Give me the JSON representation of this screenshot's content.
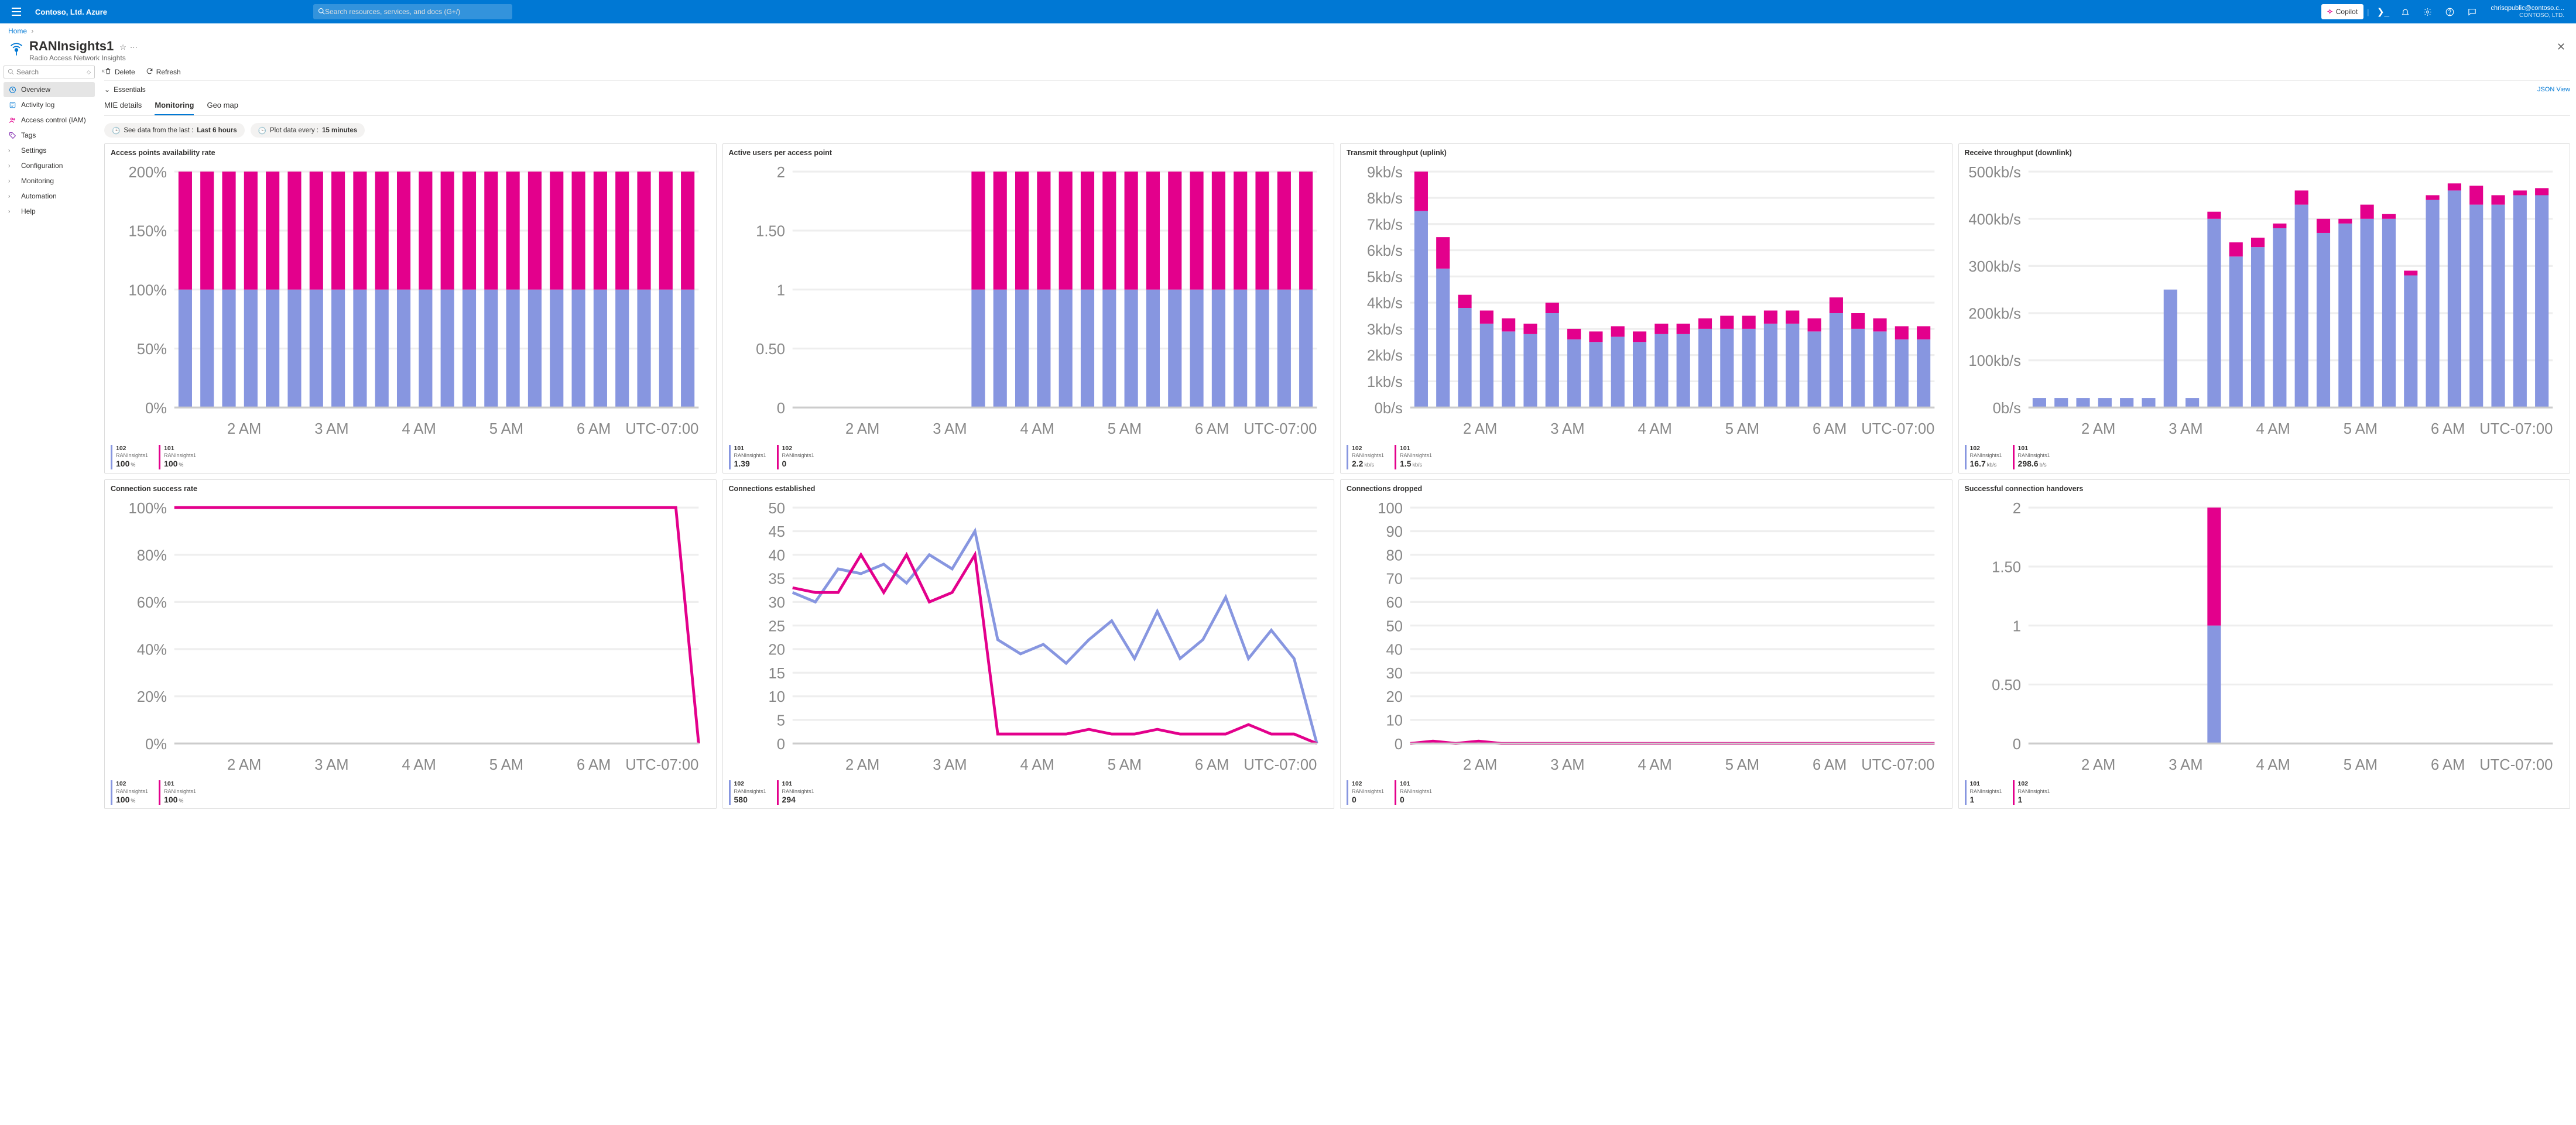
{
  "topbar": {
    "brand": "Contoso, Ltd. Azure",
    "search_placeholder": "Search resources, services, and docs (G+/)",
    "copilot": "Copilot",
    "user_email": "chrisqpublic@contoso.c...",
    "user_dir": "CONTOSO, LTD."
  },
  "breadcrumb": {
    "home": "Home"
  },
  "resource": {
    "title": "RANInsights1",
    "subtitle": "Radio Access Network Insights"
  },
  "sidebar": {
    "search_placeholder": "Search",
    "items": [
      {
        "label": "Overview",
        "icon": "overview",
        "selected": true,
        "color": "#0078d4"
      },
      {
        "label": "Activity log",
        "icon": "activity",
        "selected": false,
        "color": "#0078d4"
      },
      {
        "label": "Access control (IAM)",
        "icon": "iam",
        "selected": false,
        "color": "#e3008c"
      },
      {
        "label": "Tags",
        "icon": "tags",
        "selected": false,
        "color": "#7719aa"
      },
      {
        "label": "Settings",
        "icon": "chev",
        "selected": false
      },
      {
        "label": "Configuration",
        "icon": "chev",
        "selected": false
      },
      {
        "label": "Monitoring",
        "icon": "chev",
        "selected": false
      },
      {
        "label": "Automation",
        "icon": "chev",
        "selected": false
      },
      {
        "label": "Help",
        "icon": "chev",
        "selected": false
      }
    ]
  },
  "toolbar": {
    "delete": "Delete",
    "refresh": "Refresh"
  },
  "essentials": {
    "label": "Essentials",
    "json_view": "JSON View"
  },
  "tabs": [
    "MIE details",
    "Monitoring",
    "Geo map"
  ],
  "active_tab": 1,
  "pills": {
    "range_label": "See data from the last :",
    "range_value": "Last 6 hours",
    "gran_label": "Plot data every :",
    "gran_value": "15 minutes"
  },
  "common_x": [
    "2 AM",
    "3 AM",
    "4 AM",
    "5 AM",
    "6 AM"
  ],
  "tz": "UTC-07:00",
  "chart_data": [
    {
      "title": "Access points availability rate",
      "type": "bar-stacked",
      "yticks": [
        "0%",
        "50%",
        "100%",
        "150%",
        "200%"
      ],
      "ylim": [
        0,
        200
      ],
      "categories_count": 24,
      "series": [
        {
          "name": "102",
          "sub": "RANInsights1",
          "value": "100",
          "unit": "%",
          "values": [
            100,
            100,
            100,
            100,
            100,
            100,
            100,
            100,
            100,
            100,
            100,
            100,
            100,
            100,
            100,
            100,
            100,
            100,
            100,
            100,
            100,
            100,
            100,
            100
          ]
        },
        {
          "name": "101",
          "sub": "RANInsights1",
          "value": "100",
          "unit": "%",
          "values": [
            100,
            100,
            100,
            100,
            100,
            100,
            100,
            100,
            100,
            100,
            100,
            100,
            100,
            100,
            100,
            100,
            100,
            100,
            100,
            100,
            100,
            100,
            100,
            100
          ]
        }
      ]
    },
    {
      "title": "Active users per access point",
      "type": "bar-stacked",
      "yticks": [
        "0",
        "0.50",
        "1",
        "1.50",
        "2"
      ],
      "ylim": [
        0,
        2
      ],
      "categories_count": 24,
      "series": [
        {
          "name": "101",
          "sub": "RANInsights1",
          "value": "1.39",
          "unit": "",
          "values": [
            0,
            0,
            0,
            0,
            0,
            0,
            0,
            0,
            1,
            1,
            1,
            1,
            1,
            1,
            1,
            1,
            1,
            1,
            1,
            1,
            1,
            1,
            1,
            1
          ]
        },
        {
          "name": "102",
          "sub": "RANInsights1",
          "value": "0",
          "unit": "",
          "values": [
            0,
            0,
            0,
            0,
            0,
            0,
            0,
            0,
            1,
            1,
            1,
            1,
            1,
            1,
            1,
            1,
            1,
            1,
            1,
            1,
            1,
            1,
            1,
            1
          ]
        }
      ]
    },
    {
      "title": "Transmit throughput (uplink)",
      "type": "bar-stacked",
      "yticks": [
        "0b/s",
        "1kb/s",
        "2kb/s",
        "3kb/s",
        "4kb/s",
        "5kb/s",
        "6kb/s",
        "7kb/s",
        "8kb/s",
        "9kb/s"
      ],
      "ylim": [
        0,
        9
      ],
      "categories_count": 24,
      "series": [
        {
          "name": "102",
          "sub": "RANInsights1",
          "value": "2.2",
          "unit": "kb/s",
          "values": [
            7.5,
            5.3,
            3.8,
            3.2,
            2.9,
            2.8,
            3.6,
            2.6,
            2.5,
            2.7,
            2.5,
            2.8,
            2.8,
            3.0,
            3.0,
            3.0,
            3.2,
            3.2,
            2.9,
            3.6,
            3.0,
            2.9,
            2.6,
            2.6
          ]
        },
        {
          "name": "101",
          "sub": "RANInsights1",
          "value": "1.5",
          "unit": "kb/s",
          "values": [
            1.5,
            1.2,
            0.5,
            0.5,
            0.5,
            0.4,
            0.4,
            0.4,
            0.4,
            0.4,
            0.4,
            0.4,
            0.4,
            0.4,
            0.5,
            0.5,
            0.5,
            0.5,
            0.5,
            0.6,
            0.6,
            0.5,
            0.5,
            0.5
          ]
        }
      ]
    },
    {
      "title": "Receive throughput (downlink)",
      "type": "bar-stacked",
      "yticks": [
        "0b/s",
        "100kb/s",
        "200kb/s",
        "300kb/s",
        "400kb/s",
        "500kb/s"
      ],
      "ylim": [
        0,
        500
      ],
      "categories_count": 24,
      "series": [
        {
          "name": "102",
          "sub": "RANInsights1",
          "value": "16.7",
          "unit": "kb/s",
          "values": [
            20,
            20,
            20,
            20,
            20,
            20,
            250,
            20,
            400,
            320,
            340,
            380,
            430,
            370,
            390,
            400,
            400,
            280,
            440,
            460,
            430,
            430,
            450,
            450
          ]
        },
        {
          "name": "101",
          "sub": "RANInsights1",
          "value": "298.6",
          "unit": "b/s",
          "values": [
            0,
            0,
            0,
            0,
            0,
            0,
            0,
            0,
            15,
            30,
            20,
            10,
            30,
            30,
            10,
            30,
            10,
            10,
            10,
            15,
            40,
            20,
            10,
            15
          ]
        }
      ]
    },
    {
      "title": "Connection success rate",
      "type": "line",
      "yticks": [
        "0%",
        "20%",
        "40%",
        "60%",
        "80%",
        "100%"
      ],
      "ylim": [
        0,
        100
      ],
      "categories_count": 24,
      "series": [
        {
          "name": "102",
          "sub": "RANInsights1",
          "value": "100",
          "unit": "%",
          "color": "s2",
          "values": [
            100,
            100,
            100,
            100,
            100,
            100,
            100,
            100,
            100,
            100,
            100,
            100,
            100,
            100,
            100,
            100,
            100,
            100,
            100,
            100,
            100,
            100,
            100,
            0
          ]
        },
        {
          "name": "101",
          "sub": "RANInsights1",
          "value": "100",
          "unit": "%",
          "hidden": true
        }
      ]
    },
    {
      "title": "Connections established",
      "type": "line",
      "yticks": [
        "0",
        "5",
        "10",
        "15",
        "20",
        "25",
        "30",
        "35",
        "40",
        "45",
        "50"
      ],
      "ylim": [
        0,
        50
      ],
      "categories_count": 24,
      "series": [
        {
          "name": "102",
          "sub": "RANInsights1",
          "value": "580",
          "unit": "",
          "color": "s1",
          "values": [
            32,
            30,
            37,
            36,
            38,
            34,
            40,
            37,
            45,
            22,
            19,
            21,
            17,
            22,
            26,
            18,
            28,
            18,
            22,
            31,
            18,
            24,
            18,
            0
          ]
        },
        {
          "name": "101",
          "sub": "RANInsights1",
          "value": "294",
          "unit": "",
          "color": "s2",
          "values": [
            33,
            32,
            32,
            40,
            32,
            40,
            30,
            32,
            40,
            2,
            2,
            2,
            2,
            3,
            2,
            2,
            3,
            2,
            2,
            2,
            4,
            2,
            2,
            0
          ]
        }
      ]
    },
    {
      "title": "Connections dropped",
      "type": "line",
      "yticks": [
        "0",
        "10",
        "20",
        "30",
        "40",
        "50",
        "60",
        "70",
        "80",
        "90",
        "100"
      ],
      "ylim": [
        0,
        100
      ],
      "categories_count": 24,
      "series": [
        {
          "name": "102",
          "sub": "RANInsights1",
          "value": "0",
          "unit": "",
          "color": "s2",
          "values": [
            0,
            1,
            0,
            1,
            0,
            0,
            0,
            0,
            0,
            0,
            0,
            0,
            0,
            0,
            0,
            0,
            0,
            0,
            0,
            0,
            0,
            0,
            0,
            0
          ]
        },
        {
          "name": "101",
          "sub": "RANInsights1",
          "value": "0",
          "unit": "",
          "hidden": true
        }
      ]
    },
    {
      "title": "Successful connection handovers",
      "type": "bar-stacked",
      "yticks": [
        "0",
        "0.50",
        "1",
        "1.50",
        "2"
      ],
      "ylim": [
        0,
        2
      ],
      "categories_count": 24,
      "series": [
        {
          "name": "101",
          "sub": "RANInsights1",
          "value": "1",
          "unit": "",
          "values": [
            0,
            0,
            0,
            0,
            0,
            0,
            0,
            0,
            1,
            0,
            0,
            0,
            0,
            0,
            0,
            0,
            0,
            0,
            0,
            0,
            0,
            0,
            0,
            0
          ]
        },
        {
          "name": "102",
          "sub": "RANInsights1",
          "value": "1",
          "unit": "",
          "values": [
            0,
            0,
            0,
            0,
            0,
            0,
            0,
            0,
            1,
            0,
            0,
            0,
            0,
            0,
            0,
            0,
            0,
            0,
            0,
            0,
            0,
            0,
            0,
            0
          ]
        }
      ]
    }
  ]
}
